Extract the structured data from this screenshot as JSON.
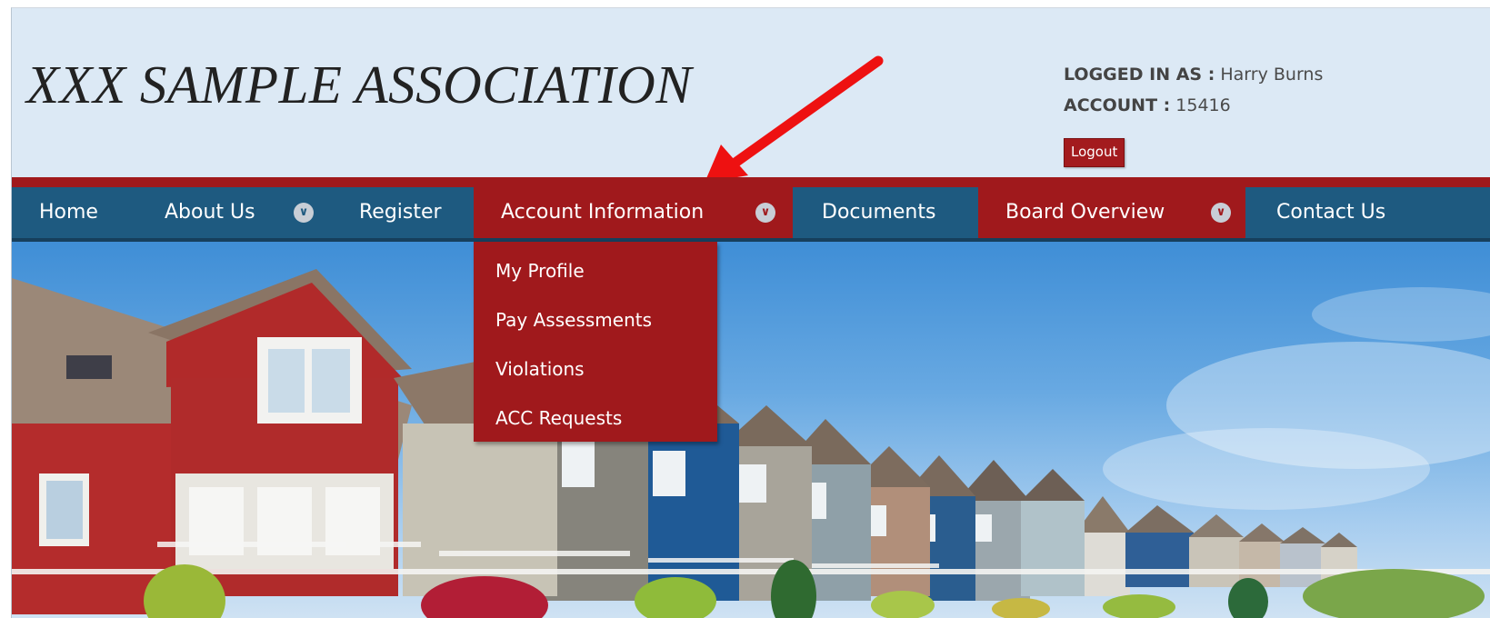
{
  "site": {
    "title": "XXX SAMPLE ASSOCIATION"
  },
  "account": {
    "logged_in_label": "LOGGED IN AS :",
    "logged_in_value": "Harry Burns",
    "account_label": "ACCOUNT :",
    "account_value": "15416",
    "logout_label": "Logout"
  },
  "nav": {
    "items": [
      {
        "label": "Home"
      },
      {
        "label": "About Us"
      },
      {
        "label": "Register"
      },
      {
        "label": "Account Information"
      },
      {
        "label": "Documents"
      },
      {
        "label": "Board Overview"
      },
      {
        "label": "Contact Us"
      }
    ]
  },
  "dropdown": {
    "items": [
      {
        "label": "My Profile"
      },
      {
        "label": "Pay Assessments"
      },
      {
        "label": "Violations"
      },
      {
        "label": "ACC Requests"
      }
    ]
  },
  "icons": {
    "dropdown": "chevron-down-icon",
    "annotation": "red-arrow-icon"
  },
  "colors": {
    "nav_blue": "#1e5a80",
    "accent_red": "#a0191c",
    "header_bg": "#dce9f5"
  }
}
